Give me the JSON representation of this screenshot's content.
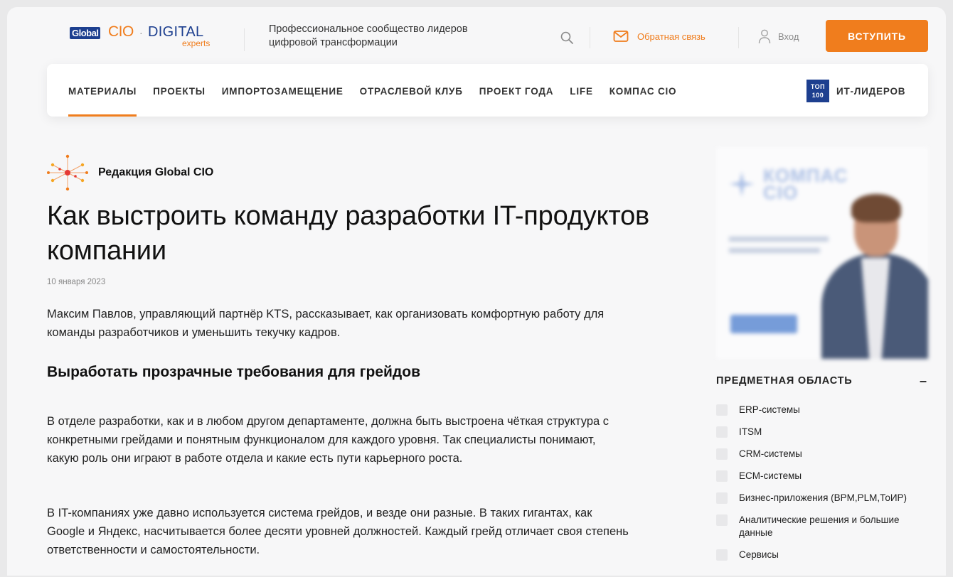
{
  "header": {
    "logo": {
      "global": "Global",
      "cio": "CIO",
      "dot": "·",
      "digital": "DIGITAL",
      "experts": "experts"
    },
    "tagline": "Профессиональное сообщество лидеров цифровой трансформации",
    "feedback_label": "Обратная связь",
    "login_label": "Вход",
    "join_label": "ВСТУПИТЬ",
    "accent_color": "#f07d1d",
    "brand_color": "#1d3f8f"
  },
  "nav": {
    "items": [
      {
        "label": "МАТЕРИАЛЫ",
        "active": true
      },
      {
        "label": "ПРОЕКТЫ"
      },
      {
        "label": "ИМПОРТОЗАМЕЩЕНИЕ"
      },
      {
        "label": "ОТРАСЛЕВОЙ КЛУБ"
      },
      {
        "label": "ПРОЕКТ ГОДА"
      },
      {
        "label": "LIFE"
      },
      {
        "label": "КОМПАС CIO"
      }
    ],
    "top100": {
      "badge_line1": "ТОП",
      "badge_line2": "100",
      "label": "ИТ-ЛИДЕРОВ"
    }
  },
  "article": {
    "author": "Редакция Global CIO",
    "title": "Как выстроить команду разработки IT-продуктов компании",
    "date": "10 января 2023",
    "lead": "Максим Павлов, управляющий партнёр KTS, рассказывает, как организовать комфортную работу для команды разработчиков и уменьшить текучку кадров.",
    "heading": "Выработать прозрачные требования для грейдов",
    "paragraphs": [
      "В отделе разработки, как и в любом другом департаменте, должна быть выстроена чёткая структура с конкретными грейдами и понятным функционалом для каждого уровня. Так специалисты понимают, какую роль они играют в работе отдела и какие есть пути карьерного роста.",
      "В IT-компаниях уже давно используется система грейдов, и везде они разные. В таких гигантах, как Google и Яндекс, насчитывается более десяти уровней должностей. Каждый грейд отличает своя степень ответственности и самостоятельности."
    ]
  },
  "banner": {
    "logo_line1": "КОМПАС",
    "logo_line2": "CIO"
  },
  "filter": {
    "title": "ПРЕДМЕТНАЯ ОБЛАСТЬ",
    "collapse_symbol": "–",
    "items": [
      "ERP-системы",
      "ITSM",
      "CRM-системы",
      "ECM-системы",
      "Бизнес-приложения (BPM,PLM,ТоИР)",
      "Аналитические решения и большие данные",
      "Сервисы"
    ]
  }
}
